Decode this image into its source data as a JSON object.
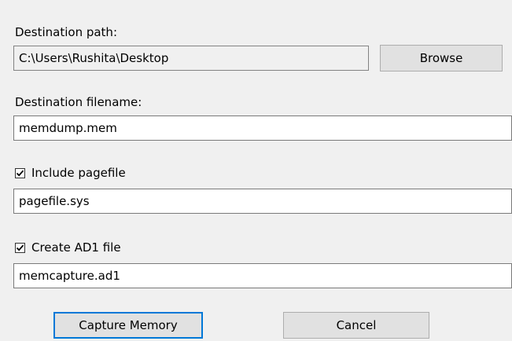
{
  "destination_path": {
    "label": "Destination path:",
    "value": "C:\\Users\\Rushita\\Desktop",
    "browse_label": "Browse"
  },
  "destination_filename": {
    "label": "Destination filename:",
    "value": "memdump.mem"
  },
  "pagefile": {
    "checkbox_label": "Include pagefile",
    "checked": true,
    "value": "pagefile.sys"
  },
  "ad1": {
    "checkbox_label": "Create AD1 file",
    "checked": true,
    "value": "memcapture.ad1"
  },
  "actions": {
    "capture_label": "Capture Memory",
    "cancel_label": "Cancel"
  }
}
